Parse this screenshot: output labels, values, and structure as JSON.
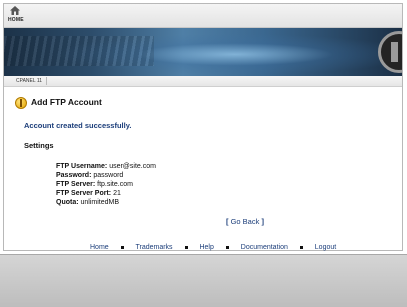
{
  "topbar": {
    "home_label": "HOME"
  },
  "subbar": {
    "tab_label": "CPANEL 11"
  },
  "page": {
    "title": "Add FTP Account",
    "success_message": "Account created successfully.",
    "settings_heading": "Settings"
  },
  "settings": [
    {
      "label": "FTP Username:",
      "value": "user@site.com"
    },
    {
      "label": "Password:",
      "value": "password"
    },
    {
      "label": "FTP Server:",
      "value": "ftp.site.com"
    },
    {
      "label": "FTP Server Port:",
      "value": "21"
    },
    {
      "label": "Quota:",
      "value": "unlimitedMB"
    }
  ],
  "go_back": {
    "open": "[",
    "label": "Go Back",
    "close": "]"
  },
  "footer": {
    "links": [
      "Home",
      "Trademarks",
      "Help",
      "Documentation",
      "Logout"
    ]
  },
  "colors": {
    "link": "#1c3e7a",
    "banner": "#2d4d6b"
  }
}
